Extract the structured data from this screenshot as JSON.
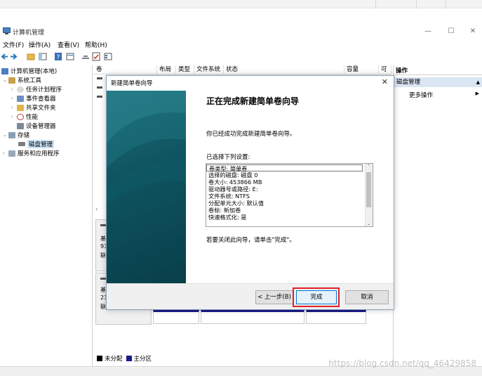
{
  "window": {
    "title": "计算机管理"
  },
  "menu": [
    "文件(F)",
    "操作(A)",
    "查看(V)",
    "帮助(H)"
  ],
  "tree": {
    "root": "计算机管理(本地)",
    "system_tools": "系统工具",
    "task_scheduler": "任务计划程序",
    "event_viewer": "事件查看器",
    "shared_folders": "共享文件夹",
    "performance": "性能",
    "device_manager": "设备管理器",
    "storage": "存储",
    "disk_management": "磁盘管理",
    "services_apps": "服务和应用程序"
  },
  "columns": [
    "卷",
    "布局",
    "类型",
    "文件系统",
    "状态",
    "容量",
    "可"
  ],
  "disks": [
    {
      "line1": "基",
      "line2": "93",
      "line3": "联"
    },
    {
      "line1": "基",
      "line2": "23",
      "line3": "联"
    }
  ],
  "legend": {
    "unallocated": "未分配",
    "primary": "主分区",
    "unallocated_color": "#000000",
    "primary_color": "#1a1a8c"
  },
  "actions": {
    "header": "操作",
    "section": "磁盘管理",
    "more": "更多操作"
  },
  "wizard": {
    "title": "新建简单卷向导",
    "heading": "正在完成新建简单卷向导",
    "description": "你已经成功完成新建简单卷向导。",
    "selected_header": "已选择下列设置:",
    "settings": [
      "卷类型: 简单卷",
      "选择的磁盘: 磁盘 0",
      "卷大小: 453866 MB",
      "驱动器号或路径: E:",
      "文件系统: NTFS",
      "分配单元大小: 默认值",
      "卷标: 新加卷",
      "快速格式化: 是"
    ],
    "finish_note": "若要关闭此向导，请单击\"完成\"。",
    "back_label": "< 上一步(B)",
    "finish_label": "完成",
    "cancel_label": "取消"
  },
  "watermark": "https://blog.csdn.net/qq_46429858",
  "colors": {
    "highlight": "#e0202a",
    "selection": "#cce4f7",
    "action_section": "#dbe6f4"
  }
}
